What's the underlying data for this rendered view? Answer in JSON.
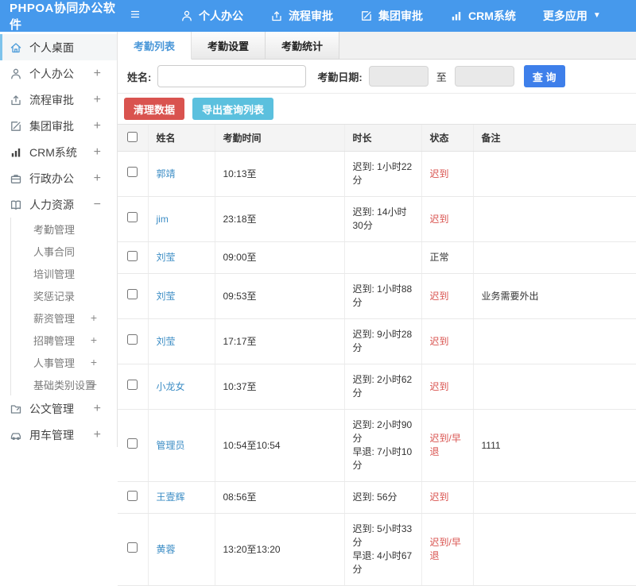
{
  "header": {
    "logo": "PHPOA协同办公软件",
    "nav": [
      {
        "name": "personal-office",
        "label": "个人办公",
        "icon": "user-icon"
      },
      {
        "name": "workflow-approval",
        "label": "流程审批",
        "icon": "flow-icon"
      },
      {
        "name": "group-approval",
        "label": "集团审批",
        "icon": "edit-icon"
      },
      {
        "name": "crm-system",
        "label": "CRM系统",
        "icon": "chart-icon"
      },
      {
        "name": "more-apps",
        "label": "更多应用",
        "icon": "",
        "caret": "▼"
      }
    ]
  },
  "sidebar": {
    "items": [
      {
        "name": "personal-desktop",
        "label": "个人桌面",
        "icon": "home-icon",
        "active": true,
        "expand": ""
      },
      {
        "name": "personal-office",
        "label": "个人办公",
        "icon": "user-icon",
        "expand": "+"
      },
      {
        "name": "workflow-approval",
        "label": "流程审批",
        "icon": "flow-icon",
        "expand": "+"
      },
      {
        "name": "group-approval",
        "label": "集团审批",
        "icon": "edit-icon",
        "expand": "+"
      },
      {
        "name": "crm-system",
        "label": "CRM系统",
        "icon": "chart-icon",
        "expand": "+"
      },
      {
        "name": "admin-office",
        "label": "行政办公",
        "icon": "briefcase-icon",
        "expand": "+"
      },
      {
        "name": "human-resources",
        "label": "人力资源",
        "icon": "book-icon",
        "expand": "−"
      },
      {
        "name": "attendance-management",
        "label": "考勤管理",
        "sub": true,
        "expand": ""
      },
      {
        "name": "personnel-contract",
        "label": "人事合同",
        "sub": true,
        "expand": ""
      },
      {
        "name": "training-management",
        "label": "培训管理",
        "sub": true,
        "expand": ""
      },
      {
        "name": "reward-punishment-records",
        "label": "奖惩记录",
        "sub": true,
        "expand": ""
      },
      {
        "name": "salary-management",
        "label": "薪资管理",
        "sub": true,
        "expand": "+"
      },
      {
        "name": "recruitment-management",
        "label": "招聘管理",
        "sub": true,
        "expand": "+"
      },
      {
        "name": "personnel-management",
        "label": "人事管理",
        "sub": true,
        "expand": "+"
      },
      {
        "name": "basic-category-settings",
        "label": "基础类别设置",
        "sub": true,
        "expand": "+"
      },
      {
        "name": "document-management",
        "label": "公文管理",
        "icon": "folder-icon",
        "expand": "+"
      },
      {
        "name": "vehicle-management",
        "label": "用车管理",
        "icon": "car-icon",
        "expand": "+"
      }
    ]
  },
  "tabs": [
    {
      "name": "attendance-list",
      "label": "考勤列表",
      "active": true
    },
    {
      "name": "attendance-settings",
      "label": "考勤设置",
      "active": false
    },
    {
      "name": "attendance-statistics",
      "label": "考勤统计",
      "active": false
    }
  ],
  "search": {
    "name_label": "姓名:",
    "name_value": "",
    "date_label": "考勤日期:",
    "date_from_value": "",
    "to_label": "至",
    "date_to_value": "",
    "query_button": "查 询"
  },
  "actions": {
    "clear_button": "清理数据",
    "export_button": "导出查询列表"
  },
  "table": {
    "col_widths": [
      "38px",
      "84px",
      "163px",
      "97px",
      "65px",
      "auto"
    ],
    "headers": [
      "姓名",
      "考勤时间",
      "时长",
      "状态",
      "备注"
    ],
    "rows": [
      {
        "name": "郭靖",
        "time": "10:13至",
        "duration": [
          "迟到: 1小时22分"
        ],
        "status": "迟到",
        "status_red": true,
        "remark": ""
      },
      {
        "name": "jim",
        "time": "23:18至",
        "duration": [
          "迟到: 14小时30分"
        ],
        "status": "迟到",
        "status_red": true,
        "remark": ""
      },
      {
        "name": "刘莹",
        "time": "09:00至",
        "duration": [],
        "status": "正常",
        "status_red": false,
        "remark": ""
      },
      {
        "name": "刘莹",
        "time": "09:53至",
        "duration": [
          "迟到: 1小时88分"
        ],
        "status": "迟到",
        "status_red": true,
        "remark": "业务需要外出"
      },
      {
        "name": "刘莹",
        "time": "17:17至",
        "duration": [
          "迟到: 9小时28分"
        ],
        "status": "迟到",
        "status_red": true,
        "remark": ""
      },
      {
        "name": "小龙女",
        "time": "10:37至",
        "duration": [
          "迟到: 2小时62分"
        ],
        "status": "迟到",
        "status_red": true,
        "remark": ""
      },
      {
        "name": "管理员",
        "time": "10:54至10:54",
        "duration": [
          "迟到: 2小时90分",
          "早退: 7小时10分"
        ],
        "status": "迟到/早退",
        "status_red": true,
        "remark": "1111"
      },
      {
        "name": "王壹辉",
        "time": "08:56至",
        "duration": [
          "迟到: 56分"
        ],
        "status": "迟到",
        "status_red": true,
        "remark": ""
      },
      {
        "name": "黄蓉",
        "time": "13:20至13:20",
        "duration": [
          "迟到: 5小时33分",
          "早退: 4小时67分"
        ],
        "status": "迟到/早退",
        "status_red": true,
        "remark": ""
      }
    ]
  },
  "colors": {
    "topbar_blue": "#4699ec",
    "active_tab_blue": "#4a97d8",
    "query_button_blue": "#3e7fea",
    "clear_button_red": "#d9534f",
    "export_button_cyan": "#5bc0de",
    "status_red": "#d9534f",
    "name_link_blue": "#3c8dc5",
    "sidebar_active_border": "#7dc3ec"
  }
}
